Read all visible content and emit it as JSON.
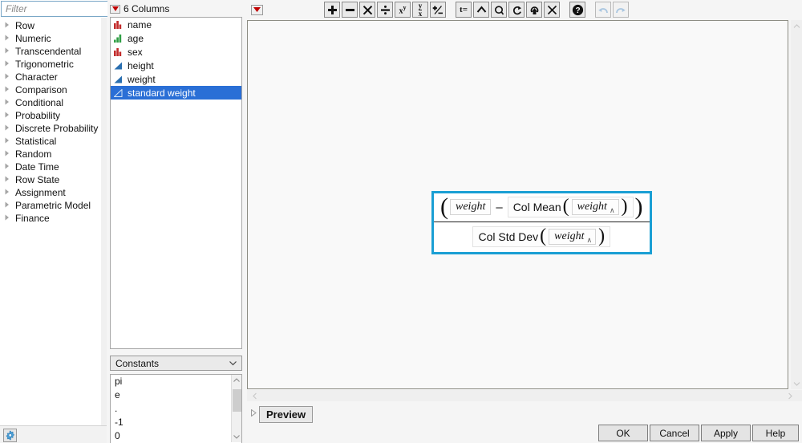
{
  "filter": {
    "placeholder": "Filter",
    "value": "",
    "search_icon": "search-icon",
    "dropdown_icon": "chevron-down-icon"
  },
  "categories": [
    {
      "label": "Row"
    },
    {
      "label": "Numeric"
    },
    {
      "label": "Transcendental"
    },
    {
      "label": "Trigonometric"
    },
    {
      "label": "Character"
    },
    {
      "label": "Comparison"
    },
    {
      "label": "Conditional"
    },
    {
      "label": "Probability"
    },
    {
      "label": "Discrete Probability"
    },
    {
      "label": "Statistical"
    },
    {
      "label": "Random"
    },
    {
      "label": "Date Time"
    },
    {
      "label": "Row State"
    },
    {
      "label": "Assignment"
    },
    {
      "label": "Parametric Model"
    },
    {
      "label": "Finance"
    }
  ],
  "settings_button": {
    "icon": "gear-icon"
  },
  "columns_panel": {
    "header": "6 Columns",
    "header_icon": "red-triangle-menu-icon",
    "items": [
      {
        "label": "name",
        "type": "nominal",
        "icon": "red-bar-chart-icon",
        "selected": false
      },
      {
        "label": "age",
        "type": "ordinal",
        "icon": "green-bar-chart-icon",
        "selected": false
      },
      {
        "label": "sex",
        "type": "nominal",
        "icon": "red-bar-chart-icon",
        "selected": false
      },
      {
        "label": "height",
        "type": "continuous",
        "icon": "blue-triangle-icon",
        "selected": false
      },
      {
        "label": "weight",
        "type": "continuous",
        "icon": "blue-triangle-icon",
        "selected": false
      },
      {
        "label": "standard weight",
        "type": "continuous",
        "icon": "blue-triangle-icon",
        "selected": true
      }
    ]
  },
  "constants": {
    "selected": "Constants",
    "dropdown_icon": "chevron-down-icon",
    "items": [
      "pi",
      "e",
      ".",
      "-1",
      "0"
    ]
  },
  "toolbar": {
    "red_triangle": "red-triangle-menu-icon",
    "buttons": [
      {
        "name": "add-button",
        "glyph": "➕",
        "label": "+"
      },
      {
        "name": "subtract-button",
        "glyph": "➖",
        "label": "−"
      },
      {
        "name": "multiply-button",
        "glyph": "✖",
        "label": "×"
      },
      {
        "name": "divide-button",
        "glyph": "÷",
        "label": "÷"
      },
      {
        "name": "exponent-button",
        "glyph": "xʸ",
        "label": "x^y"
      },
      {
        "name": "root-button",
        "glyph": "y/x",
        "label": "y/x"
      },
      {
        "name": "sign-toggle-button",
        "glyph": "±",
        "label": "+/-"
      },
      {
        "name": "assign-button",
        "glyph": "t=",
        "label": "t="
      },
      {
        "name": "insert-above-button",
        "glyph": "∧",
        "label": "^"
      },
      {
        "name": "peel-button",
        "glyph": "α",
        "label": "Q"
      },
      {
        "name": "swap-button",
        "glyph": "↻",
        "label": "swap"
      },
      {
        "name": "unpeel-button",
        "glyph": "↺",
        "label": "unpeel"
      },
      {
        "name": "delete-button",
        "glyph": "✕",
        "label": "X"
      },
      {
        "name": "help-button",
        "glyph": "?",
        "label": "?"
      },
      {
        "name": "undo-button",
        "glyph": "↶",
        "label": "undo",
        "disabled": true
      },
      {
        "name": "redo-button",
        "glyph": "↷",
        "label": "redo",
        "disabled": true
      }
    ]
  },
  "formula": {
    "accent_color": "#1a9fd4",
    "numerator": {
      "left_paren": "(",
      "term": "weight",
      "operator": "–",
      "function": "Col Mean",
      "arg_open": "(",
      "arg": "weight",
      "arg_caret": "∧",
      "arg_close": ")",
      "right_paren": ")"
    },
    "denominator": {
      "function": "Col Std Dev",
      "arg_open": "(",
      "arg": "weight",
      "arg_caret": "∧",
      "arg_close": ")"
    },
    "expression_text": "(weight - Col Mean(weight)) / Col Std Dev(weight)"
  },
  "preview": {
    "label": "Preview",
    "disclosure_icon": "triangle-right-icon"
  },
  "scrollbars": {
    "up_icon": "chevron-up-icon",
    "down_icon": "chevron-down-icon",
    "left_icon": "chevron-left-icon",
    "right_icon": "chevron-right-icon"
  },
  "dialog_buttons": {
    "ok": "OK",
    "cancel": "Cancel",
    "apply": "Apply",
    "help": "Help"
  }
}
